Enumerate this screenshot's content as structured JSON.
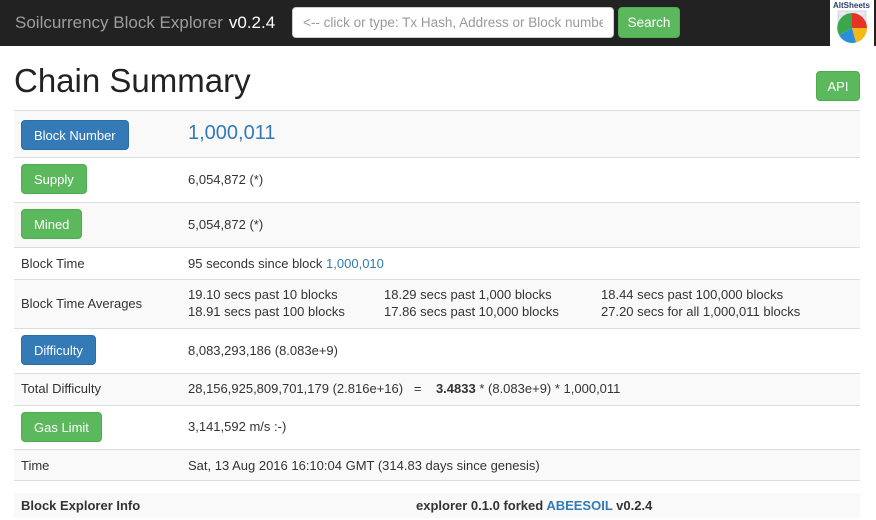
{
  "navbar": {
    "brand": "Soilcurrency Block Explorer",
    "version": "v0.2.4",
    "search_placeholder": "<-- click or type: Tx Hash, Address or Block number",
    "search_button": "Search",
    "logo_text": "AltSheets"
  },
  "page_title": "Chain Summary",
  "api_button": "API",
  "rows": {
    "block_number": {
      "label": "Block Number",
      "value": "1,000,011"
    },
    "supply": {
      "label": "Supply",
      "value": "6,054,872 (*)"
    },
    "mined": {
      "label": "Mined",
      "value": "5,054,872 (*)"
    },
    "block_time": {
      "label": "Block Time",
      "value_prefix": "95 seconds since block",
      "link": "1,000,010"
    },
    "block_time_averages": {
      "label": "Block Time Averages",
      "items": [
        "19.10 secs past 10 blocks",
        "18.29 secs past 1,000 blocks",
        "18.44 secs past 100,000 blocks",
        "18.91 secs past 100 blocks",
        "17.86 secs past 10,000 blocks",
        "27.20 secs for all 1,000,011 blocks"
      ]
    },
    "difficulty": {
      "label": "Difficulty",
      "value": "8,083,293,186 (8.083e+9)"
    },
    "total_difficulty": {
      "label": "Total Difficulty",
      "value": "28,156,925,809,701,179 (2.816e+16)",
      "equals": "=",
      "factor": "3.4833",
      "rest": "* (8.083e+9) * 1,000,011"
    },
    "gas_limit": {
      "label": "Gas Limit",
      "value": "3,141,592 m/s :-)"
    },
    "time": {
      "label": "Time",
      "value": "Sat, 13 Aug 2016 16:10:04 GMT (314.83 days since genesis)"
    }
  },
  "footer": {
    "label": "Block Explorer Info",
    "info_prefix": "explorer 0.1.0 forked",
    "info_link": "ABEESOIL",
    "info_version": "v0.2.4"
  },
  "colors": {
    "navbar_bg": "#222222",
    "primary_blue": "#337ab7",
    "success_green": "#5cb85c",
    "row_stripe": "#f9f9f9"
  }
}
